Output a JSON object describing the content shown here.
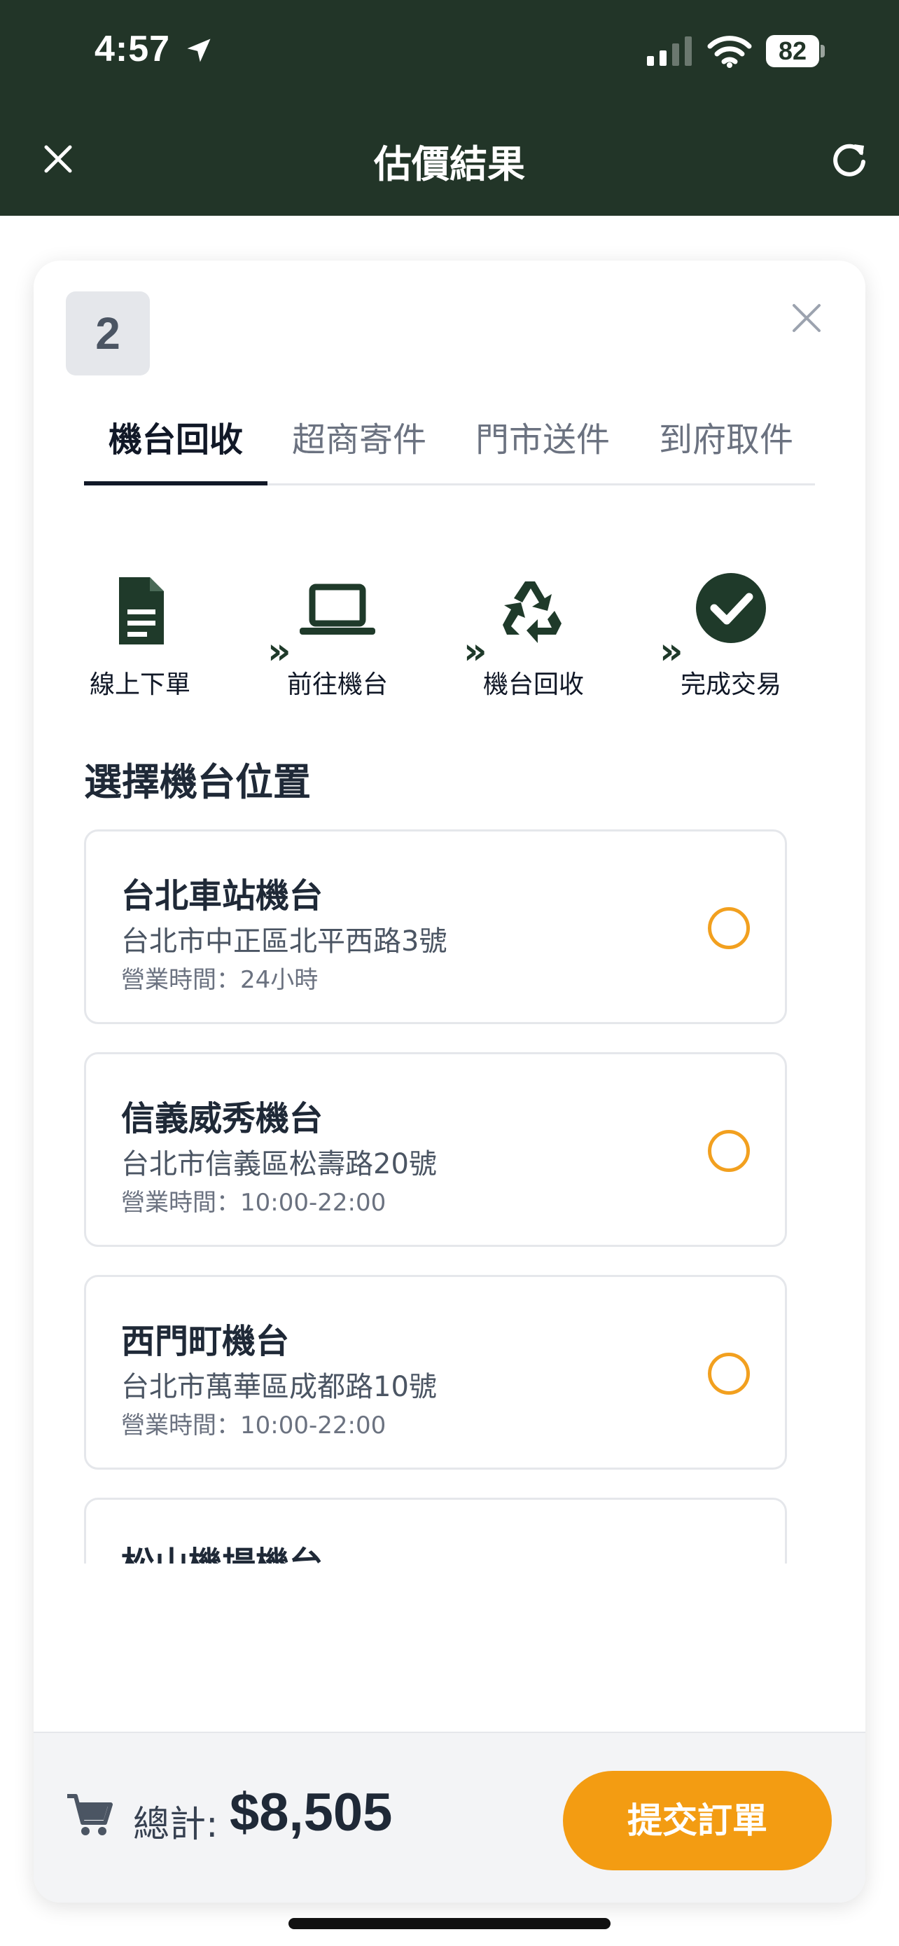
{
  "status_bar": {
    "time": "4:57",
    "battery": "82",
    "icons": [
      "location-arrow-icon",
      "cellular-signal-icon",
      "wifi-icon",
      "battery-icon"
    ]
  },
  "nav": {
    "title": "估價結果",
    "close_icon": "close-icon",
    "refresh_icon": "refresh-icon"
  },
  "card": {
    "badge": "2",
    "close_icon": "close-icon"
  },
  "tabs": [
    {
      "label": "機台回收",
      "active": true
    },
    {
      "label": "超商寄件",
      "active": false
    },
    {
      "label": "門市送件",
      "active": false
    },
    {
      "label": "到府取件",
      "active": false
    }
  ],
  "steps": [
    {
      "label": "線上下單",
      "icon": "document-icon"
    },
    {
      "label": "前往機台",
      "icon": "laptop-icon"
    },
    {
      "label": "機台回收",
      "icon": "recycle-icon"
    },
    {
      "label": "完成交易",
      "icon": "check-circle-icon"
    }
  ],
  "step_separator": "»",
  "section_title": "選擇機台位置",
  "locations": [
    {
      "name": "台北車站機台",
      "address": "台北市中正區北平西路3號",
      "hours": "營業時間：24小時",
      "selected": false
    },
    {
      "name": "信義威秀機台",
      "address": "台北市信義區松壽路20號",
      "hours": "營業時間：10:00-22:00",
      "selected": false
    },
    {
      "name": "西門町機台",
      "address": "台北市萬華區成都路10號",
      "hours": "營業時間：10:00-22:00",
      "selected": false
    },
    {
      "name": "松山機場機台",
      "address": "",
      "hours": "",
      "selected": false
    }
  ],
  "footer": {
    "cart_icon": "cart-icon",
    "total_label": "總計:",
    "total_value": "$8,505",
    "submit_label": "提交訂單"
  },
  "colors": {
    "header_bg": "#223528",
    "accent": "#f39c12",
    "radio_border": "#f2a01f",
    "step_icon": "#1f3a2a"
  }
}
